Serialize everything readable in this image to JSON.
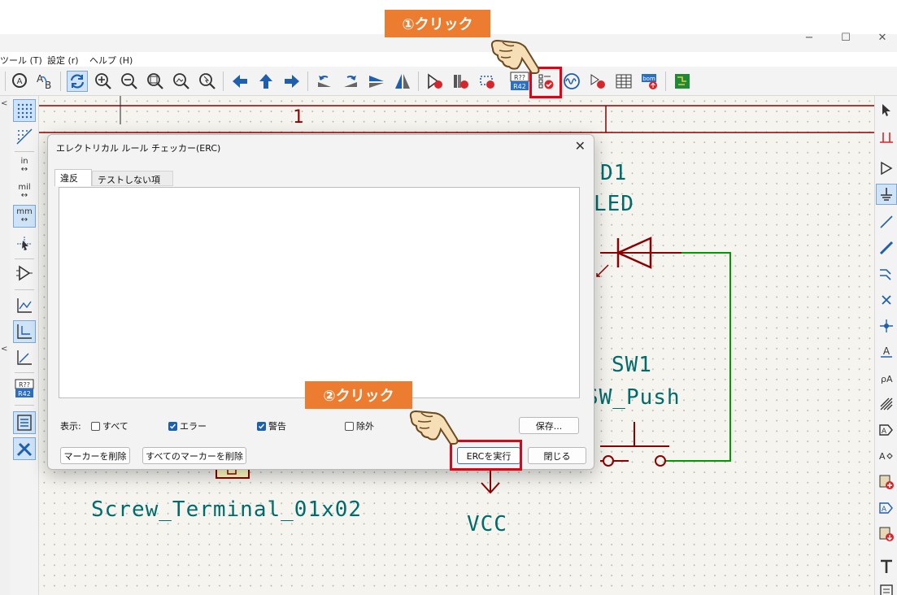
{
  "window": {
    "minimize": "−",
    "maximize": "☐",
    "close": "✕"
  },
  "menu": {
    "tools": "ツール (T)",
    "settings": "設定 (r)",
    "help": "ヘルプ (H)"
  },
  "toolbar": {
    "annotate_label": "R??\nR42"
  },
  "left_toolbar": {
    "units_in": "in",
    "units_mil": "mil",
    "units_mm": "mm",
    "annotate": "R??R42"
  },
  "schematic": {
    "sheet_number": "1",
    "d1_ref": "D1",
    "d1_value": "LED",
    "sw1_ref": "SW1",
    "sw1_value": "SW_Push",
    "connector_value": "Screw_Terminal_01x02",
    "power_label": "VCC"
  },
  "dialog": {
    "title": "エレクトリカル ルール チェッカー(ERC)",
    "tabs": [
      "違反",
      "テストしない項目"
    ],
    "filter_label": "表示:",
    "filters": [
      {
        "label": "すべて",
        "checked": false
      },
      {
        "label": "エラー",
        "checked": true
      },
      {
        "label": "警告",
        "checked": true
      },
      {
        "label": "除外",
        "checked": false
      }
    ],
    "save_button": "保存...",
    "delete_markers_button": "マーカーを削除",
    "delete_all_markers_button": "すべてのマーカーを削除",
    "run_erc_button": "ERCを実行",
    "close_button": "閉じる"
  },
  "annotations": {
    "step1": "①クリック",
    "step2": "②クリック"
  },
  "colors": {
    "callout": "#ec7c30",
    "highlight": "#e60012",
    "wire_green": "#009900",
    "component_red": "#8b0000",
    "text_teal": "#006b6b"
  }
}
